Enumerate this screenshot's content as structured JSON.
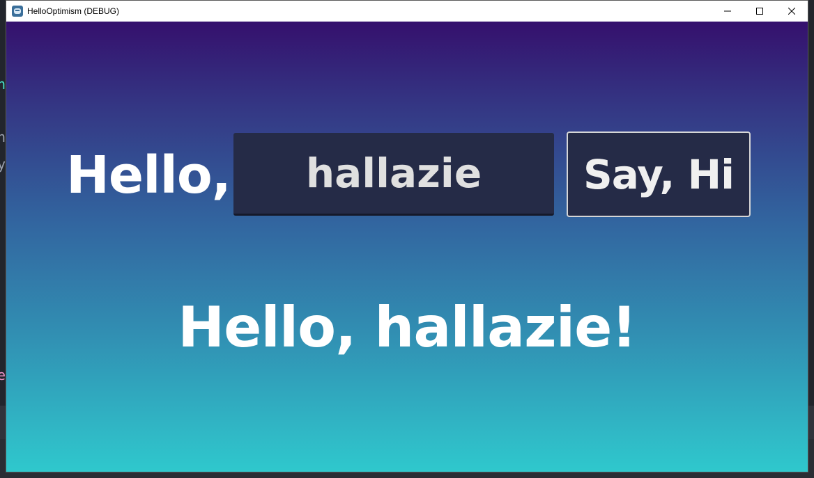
{
  "window": {
    "title": "HelloOptimism (DEBUG)",
    "icon": "godot-engine-icon"
  },
  "controls": {
    "minimize": "minimize-icon",
    "maximize": "maximize-icon",
    "close": "close-icon"
  },
  "app": {
    "hello_label": "Hello,",
    "name_value": "hallazie",
    "button_label": "Say, Hi",
    "greeting": "Hello, hallazie!"
  },
  "background_fragments": [
    "n",
    "n",
    "y",
    "e"
  ],
  "colors": {
    "gradient_top": "#35106d",
    "gradient_bottom": "#2fc8cd",
    "field_bg": "#252b47",
    "button_border": "#d6d6d6"
  }
}
